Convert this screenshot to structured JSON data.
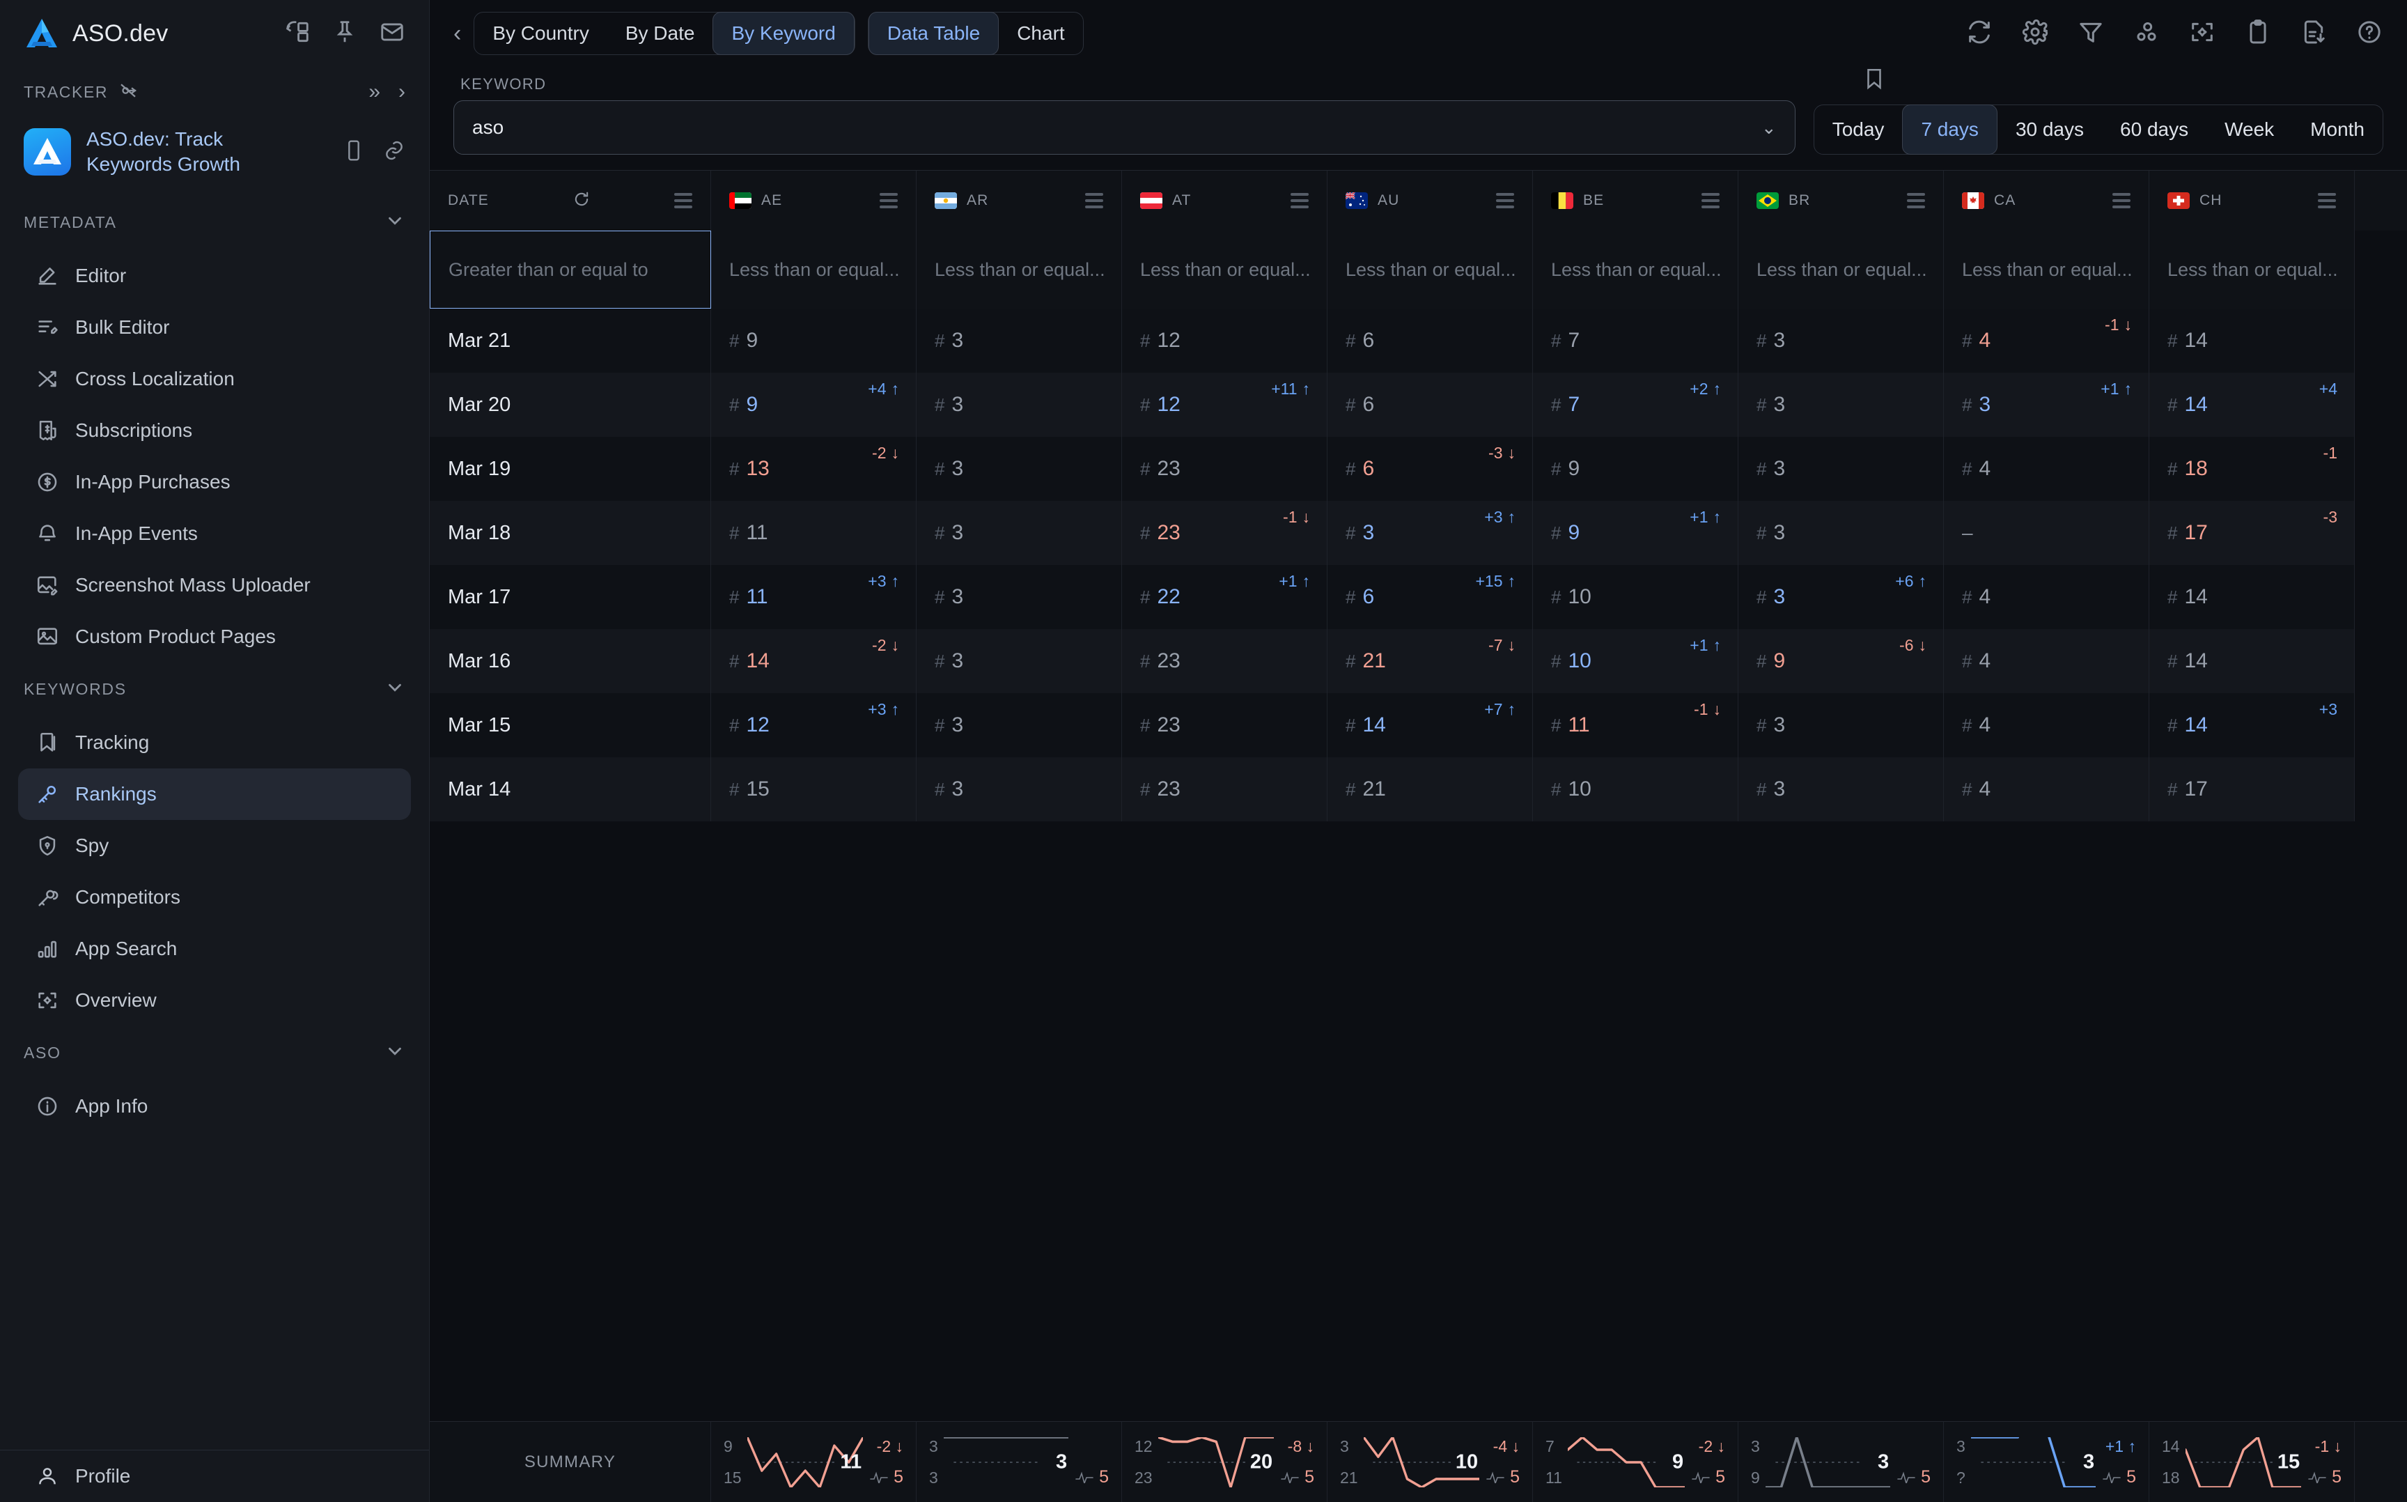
{
  "sidebar": {
    "brand": "ASO.dev",
    "tracker_label": "TRACKER",
    "app_title": "ASO.dev: Track Keywords Growth",
    "sections": [
      {
        "title": "METADATA",
        "items": [
          {
            "label": "Editor",
            "icon": "pencil-icon"
          },
          {
            "label": "Bulk Editor",
            "icon": "bulk-edit-icon"
          },
          {
            "label": "Cross Localization",
            "icon": "shuffle-icon"
          },
          {
            "label": "Subscriptions",
            "icon": "receipt-dollar-icon"
          },
          {
            "label": "In-App Purchases",
            "icon": "dollar-circle-icon"
          },
          {
            "label": "In-App Events",
            "icon": "bell-icon"
          },
          {
            "label": "Screenshot Mass Uploader",
            "icon": "image-edit-icon"
          },
          {
            "label": "Custom Product Pages",
            "icon": "image-icon"
          }
        ]
      },
      {
        "title": "KEYWORDS",
        "items": [
          {
            "label": "Tracking",
            "icon": "bookmark-icon"
          },
          {
            "label": "Rankings",
            "icon": "key-icon",
            "active": true
          },
          {
            "label": "Spy",
            "icon": "shield-lock-icon"
          },
          {
            "label": "Competitors",
            "icon": "keys-icon"
          },
          {
            "label": "App Search",
            "icon": "bar-chart-icon"
          },
          {
            "label": "Overview",
            "icon": "focus-target-icon"
          }
        ]
      },
      {
        "title": "ASO",
        "items": [
          {
            "label": "App Info",
            "icon": "info-circle-icon"
          }
        ]
      }
    ],
    "footer": {
      "label": "Profile",
      "icon": "user-icon"
    }
  },
  "topbar": {
    "back": "‹",
    "tab_groups": [
      {
        "tabs": [
          {
            "label": "By Country",
            "selected": false
          },
          {
            "label": "By Date",
            "selected": false
          },
          {
            "label": "By Keyword",
            "selected": true
          }
        ]
      },
      {
        "tabs": [
          {
            "label": "Data Table",
            "selected": true
          },
          {
            "label": "Chart",
            "selected": false
          }
        ]
      }
    ],
    "icons": [
      "refresh-icon",
      "gear-icon",
      "filter-icon",
      "cluster-icon",
      "focus-target-icon",
      "clipboard-icon",
      "export-doc-icon",
      "help-circle-icon"
    ]
  },
  "keyword_bar": {
    "label": "KEYWORD",
    "value": "aso",
    "placeholder": "aso",
    "bookmark_icon": "bookmark-icon",
    "ranges": [
      {
        "label": "Today",
        "selected": false
      },
      {
        "label": "7 days",
        "selected": true
      },
      {
        "label": "30 days",
        "selected": false
      },
      {
        "label": "60 days",
        "selected": false
      },
      {
        "label": "Week",
        "selected": false
      },
      {
        "label": "Month",
        "selected": false
      }
    ]
  },
  "table": {
    "date_header": "DATE",
    "date_filter": "Greater than or equal to",
    "country_filter": "Less than or equal...",
    "countries": [
      {
        "code": "AE",
        "flag": "ae"
      },
      {
        "code": "AR",
        "flag": "ar"
      },
      {
        "code": "AT",
        "flag": "at"
      },
      {
        "code": "AU",
        "flag": "au"
      },
      {
        "code": "BE",
        "flag": "be"
      },
      {
        "code": "BR",
        "flag": "br"
      },
      {
        "code": "CA",
        "flag": "ca"
      },
      {
        "code": "CH",
        "flag": "ch"
      }
    ],
    "rows": [
      {
        "date": "Mar 21",
        "cells": [
          {
            "rank": "9",
            "delta": null
          },
          {
            "rank": "3",
            "delta": null
          },
          {
            "rank": "12",
            "delta": null
          },
          {
            "rank": "6",
            "delta": null
          },
          {
            "rank": "7",
            "delta": null
          },
          {
            "rank": "3",
            "delta": null
          },
          {
            "rank": "4",
            "delta": "-1",
            "dir": "down"
          },
          {
            "rank": "14",
            "delta": null
          }
        ]
      },
      {
        "date": "Mar 20",
        "cells": [
          {
            "rank": "9",
            "delta": "+4",
            "dir": "up"
          },
          {
            "rank": "3",
            "delta": null
          },
          {
            "rank": "12",
            "delta": "+11",
            "dir": "up"
          },
          {
            "rank": "6",
            "delta": null
          },
          {
            "rank": "7",
            "delta": "+2",
            "dir": "up"
          },
          {
            "rank": "3",
            "delta": null
          },
          {
            "rank": "3",
            "delta": "+1",
            "dir": "up"
          },
          {
            "rank": "14",
            "delta": "+4",
            "dir": "up",
            "arrow": false
          }
        ]
      },
      {
        "date": "Mar 19",
        "cells": [
          {
            "rank": "13",
            "delta": "-2",
            "dir": "down"
          },
          {
            "rank": "3",
            "delta": null
          },
          {
            "rank": "23",
            "delta": null
          },
          {
            "rank": "6",
            "delta": "-3",
            "dir": "down"
          },
          {
            "rank": "9",
            "delta": null
          },
          {
            "rank": "3",
            "delta": null
          },
          {
            "rank": "4",
            "delta": null
          },
          {
            "rank": "18",
            "delta": "-1",
            "dir": "down",
            "arrow": false
          }
        ]
      },
      {
        "date": "Mar 18",
        "cells": [
          {
            "rank": "11",
            "delta": null
          },
          {
            "rank": "3",
            "delta": null
          },
          {
            "rank": "23",
            "delta": "-1",
            "dir": "down"
          },
          {
            "rank": "3",
            "delta": "+3",
            "dir": "up"
          },
          {
            "rank": "9",
            "delta": "+1",
            "dir": "up"
          },
          {
            "rank": "3",
            "delta": null
          },
          {
            "rank": "-",
            "delta": null,
            "nodata": true
          },
          {
            "rank": "17",
            "delta": "-3",
            "dir": "down",
            "arrow": false
          }
        ]
      },
      {
        "date": "Mar 17",
        "cells": [
          {
            "rank": "11",
            "delta": "+3",
            "dir": "up"
          },
          {
            "rank": "3",
            "delta": null
          },
          {
            "rank": "22",
            "delta": "+1",
            "dir": "up"
          },
          {
            "rank": "6",
            "delta": "+15",
            "dir": "up"
          },
          {
            "rank": "10",
            "delta": null
          },
          {
            "rank": "3",
            "delta": "+6",
            "dir": "up"
          },
          {
            "rank": "4",
            "delta": null
          },
          {
            "rank": "14",
            "delta": null
          }
        ]
      },
      {
        "date": "Mar 16",
        "cells": [
          {
            "rank": "14",
            "delta": "-2",
            "dir": "down"
          },
          {
            "rank": "3",
            "delta": null
          },
          {
            "rank": "23",
            "delta": null
          },
          {
            "rank": "21",
            "delta": "-7",
            "dir": "down"
          },
          {
            "rank": "10",
            "delta": "+1",
            "dir": "up"
          },
          {
            "rank": "9",
            "delta": "-6",
            "dir": "down"
          },
          {
            "rank": "4",
            "delta": null
          },
          {
            "rank": "14",
            "delta": null
          }
        ]
      },
      {
        "date": "Mar 15",
        "cells": [
          {
            "rank": "12",
            "delta": "+3",
            "dir": "up"
          },
          {
            "rank": "3",
            "delta": null
          },
          {
            "rank": "23",
            "delta": null
          },
          {
            "rank": "14",
            "delta": "+7",
            "dir": "up"
          },
          {
            "rank": "11",
            "delta": "-1",
            "dir": "down"
          },
          {
            "rank": "3",
            "delta": null
          },
          {
            "rank": "4",
            "delta": null
          },
          {
            "rank": "14",
            "delta": "+3",
            "dir": "up",
            "arrow": false
          }
        ]
      },
      {
        "date": "Mar 14",
        "cells": [
          {
            "rank": "15",
            "delta": null
          },
          {
            "rank": "3",
            "delta": null
          },
          {
            "rank": "23",
            "delta": null
          },
          {
            "rank": "21",
            "delta": null
          },
          {
            "rank": "10",
            "delta": null
          },
          {
            "rank": "3",
            "delta": null
          },
          {
            "rank": "4",
            "delta": null
          },
          {
            "rank": "17",
            "delta": null
          }
        ]
      }
    ],
    "summary": {
      "label": "SUMMARY",
      "columns": [
        {
          "code": "AE",
          "best": "9",
          "worst": "15",
          "value": "11",
          "delta": "-2",
          "dir": "down",
          "volatility": "5",
          "trend": "down",
          "series": [
            15,
            11,
            13,
            9,
            11,
            9,
            14,
            12,
            15
          ]
        },
        {
          "code": "AR",
          "best": "3",
          "worst": "3",
          "value": "3",
          "delta": null,
          "dir": null,
          "volatility": "5",
          "trend": "flat",
          "series": [
            3,
            3,
            3,
            3,
            3,
            3,
            3,
            3,
            3
          ]
        },
        {
          "code": "AT",
          "best": "12",
          "worst": "23",
          "value": "20",
          "delta": "-8",
          "dir": "down",
          "volatility": "5",
          "trend": "down",
          "series": [
            23,
            22,
            22,
            23,
            22,
            12,
            23,
            23,
            23
          ]
        },
        {
          "code": "AU",
          "best": "3",
          "worst": "21",
          "value": "10",
          "delta": "-4",
          "dir": "down",
          "volatility": "5",
          "trend": "down",
          "series": [
            21,
            14,
            21,
            6,
            3,
            6,
            6,
            6,
            6
          ]
        },
        {
          "code": "BE",
          "best": "7",
          "worst": "11",
          "value": "9",
          "delta": "-2",
          "dir": "down",
          "volatility": "5",
          "trend": "down",
          "series": [
            10,
            11,
            10,
            10,
            9,
            9,
            7,
            7,
            7
          ]
        },
        {
          "code": "BR",
          "best": "3",
          "worst": "9",
          "value": "3",
          "delta": null,
          "dir": null,
          "volatility": "5",
          "trend": "flat",
          "series": [
            3,
            3,
            9,
            3,
            3,
            3,
            3,
            3,
            3
          ]
        },
        {
          "code": "CA",
          "best": "3",
          "worst": "?",
          "value": "3",
          "delta": "+1",
          "dir": "up",
          "volatility": "5",
          "trend": "up",
          "series": [
            4,
            4,
            4,
            4,
            null,
            4,
            3,
            3,
            3
          ]
        },
        {
          "code": "CH",
          "best": "14",
          "worst": "18",
          "value": "15",
          "delta": "-1",
          "dir": "down",
          "volatility": "5",
          "trend": "down",
          "series": [
            17,
            14,
            14,
            14,
            17,
            18,
            14,
            14,
            14
          ]
        }
      ]
    }
  }
}
